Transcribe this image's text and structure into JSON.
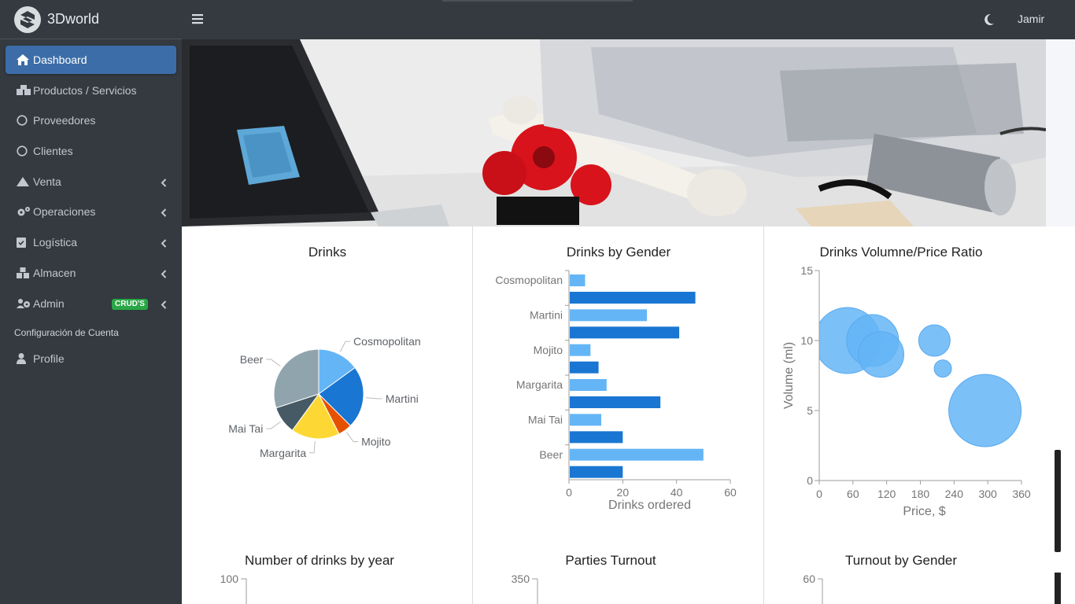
{
  "brand": {
    "name": "3Dworld",
    "logo_icon": "3dworld-logo-icon"
  },
  "topbar": {
    "menu_icon": "hamburger-icon",
    "theme_icon": "moon-icon",
    "user_name": "Jamir"
  },
  "sidebar": {
    "items": [
      {
        "label": "Dashboard",
        "icon": "home-icon",
        "active": true
      },
      {
        "label": "Productos / Servicios",
        "icon": "boxes-icon"
      },
      {
        "label": "Proveedores",
        "icon": "circle-icon"
      },
      {
        "label": "Clientes",
        "icon": "circle-icon"
      },
      {
        "label": "Venta",
        "icon": "tent-icon",
        "chevron": true
      },
      {
        "label": "Operaciones",
        "icon": "gears-icon",
        "chevron": true
      },
      {
        "label": "Logística",
        "icon": "clipboard-check-icon",
        "chevron": true
      },
      {
        "label": "Almacen",
        "icon": "warehouse-icon",
        "chevron": true
      },
      {
        "label": "Admin",
        "icon": "users-cog-icon",
        "chevron": true,
        "badge": "CRUD'S"
      }
    ],
    "section_header": "Configuración de Cuenta",
    "profile": {
      "label": "Profile",
      "icon": "user-icon"
    }
  },
  "charts": {
    "pie_title": "Drinks",
    "bar_title": "Drinks by Gender",
    "bubble_title": "Drinks Volumne/Price Ratio",
    "bottom_titles": [
      "Number of drinks by year",
      "Parties Turnout",
      "Turnout by Gender"
    ],
    "bottom_first_ticks": [
      "100",
      "350",
      "60"
    ]
  },
  "chart_data": [
    {
      "type": "pie",
      "title": "Drinks",
      "categories": [
        "Cosmopolitan",
        "Martini",
        "Mojito",
        "Margarita",
        "Mai Tai",
        "Beer"
      ],
      "values": [
        12,
        18,
        4,
        14,
        8,
        24
      ],
      "colors": [
        "#64b5f6",
        "#1976d2",
        "#e65100",
        "#fdd835",
        "#455a64",
        "#90a4ae"
      ]
    },
    {
      "type": "bar",
      "orientation": "horizontal",
      "title": "Drinks by Gender",
      "categories": [
        "Cosmopolitan",
        "Martini",
        "Mojito",
        "Margarita",
        "Mai Tai",
        "Beer"
      ],
      "xlabel": "Drinks ordered",
      "xlim": [
        0,
        60
      ],
      "xticks": [
        "0",
        "20",
        "40",
        "60"
      ],
      "series": [
        {
          "values": [
            6,
            29,
            8,
            14,
            12,
            50
          ],
          "color": "#64b5f6"
        },
        {
          "values": [
            47,
            41,
            11,
            34,
            20,
            20
          ],
          "color": "#1976d2"
        }
      ]
    },
    {
      "type": "scatter",
      "title": "Drinks Volumne/Price Ratio",
      "xlabel": "Price, $",
      "ylabel": "Volume (ml)",
      "xlim": [
        0,
        360
      ],
      "ylim": [
        0,
        15
      ],
      "xticks": [
        "0",
        "60",
        "120",
        "180",
        "240",
        "300",
        "360"
      ],
      "yticks": [
        "0",
        "5",
        "10",
        "15"
      ],
      "color": "#64b5f6",
      "points": [
        {
          "x": 50,
          "y": 10,
          "size": 42
        },
        {
          "x": 95,
          "y": 10,
          "size": 33
        },
        {
          "x": 110,
          "y": 9,
          "size": 29
        },
        {
          "x": 205,
          "y": 10,
          "size": 20
        },
        {
          "x": 220,
          "y": 8,
          "size": 11
        },
        {
          "x": 295,
          "y": 5,
          "size": 46
        }
      ]
    }
  ]
}
